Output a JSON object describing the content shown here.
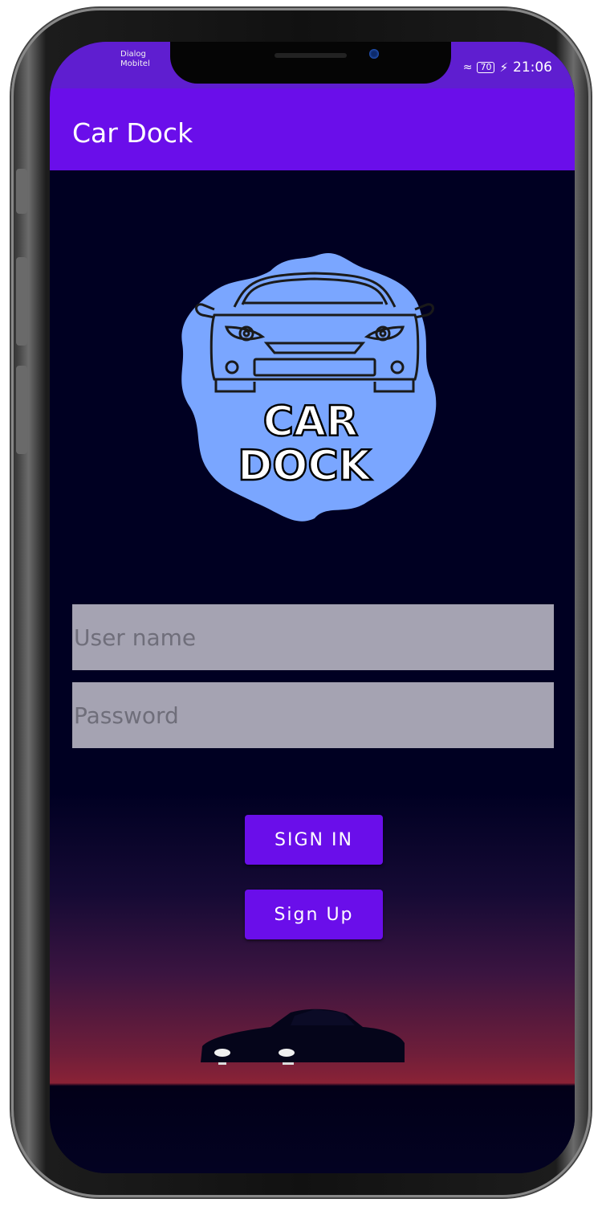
{
  "status_bar": {
    "carrier_line1": "Dialog",
    "carrier_line2": "Mobitel",
    "battery": "70",
    "time": "21:06"
  },
  "app_bar": {
    "title": "Car Dock"
  },
  "logo": {
    "line1": "CAR",
    "line2": "DOCK",
    "blob_color": "#7aa6ff"
  },
  "form": {
    "username_placeholder": "User name",
    "password_placeholder": "Password"
  },
  "buttons": {
    "sign_in": "SIGN IN",
    "sign_up": "Sign Up"
  },
  "colors": {
    "primary": "#6a0eea",
    "status_bar": "#5f1ed0",
    "background": "#000022",
    "input_bg": "#a5a3b2"
  }
}
